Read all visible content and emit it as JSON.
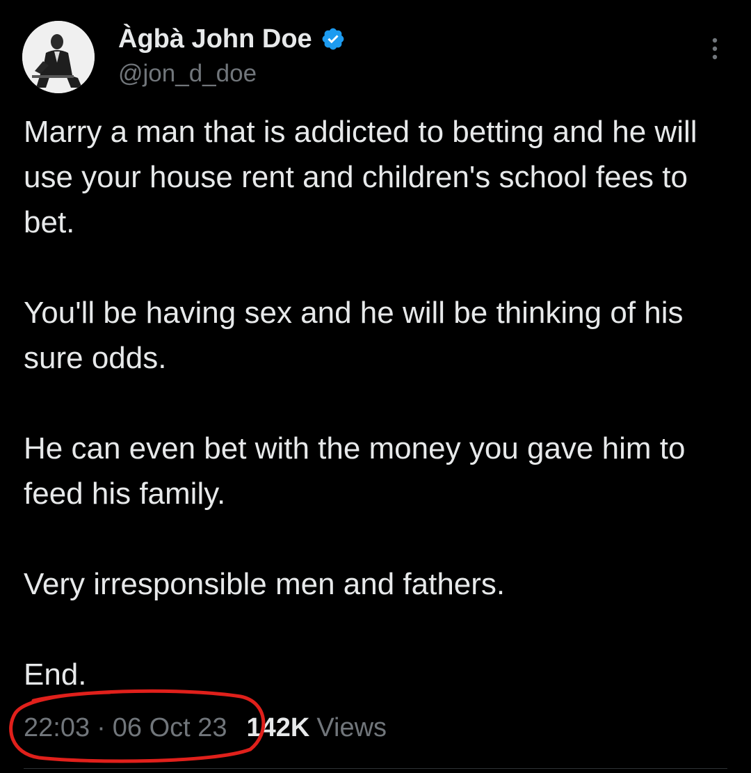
{
  "author": {
    "display_name": "Àgbà John Doe",
    "handle": "@jon_d_doe",
    "verified": true,
    "avatar_icon": "portrait-avatar"
  },
  "actions": {
    "more_icon": "more-vertical-icon"
  },
  "tweet": {
    "paragraphs": [
      "Marry a man that is addicted to betting and he will use your house rent and children's school fees to bet.",
      "You'll be having sex and he will be thinking of his sure odds.",
      "He can even bet with the money you gave him to feed his family.",
      "Very irresponsible men and fathers.",
      "End."
    ]
  },
  "meta": {
    "time": "22:03",
    "separator": "·",
    "date": "06 Oct 23",
    "views_count": "142K",
    "views_label": "Views"
  },
  "colors": {
    "background": "#000000",
    "primary_text": "#e7e9ea",
    "secondary_text": "#71767b",
    "verified_badge": "#1d9bf0",
    "annotation_circle": "#e0201b"
  }
}
